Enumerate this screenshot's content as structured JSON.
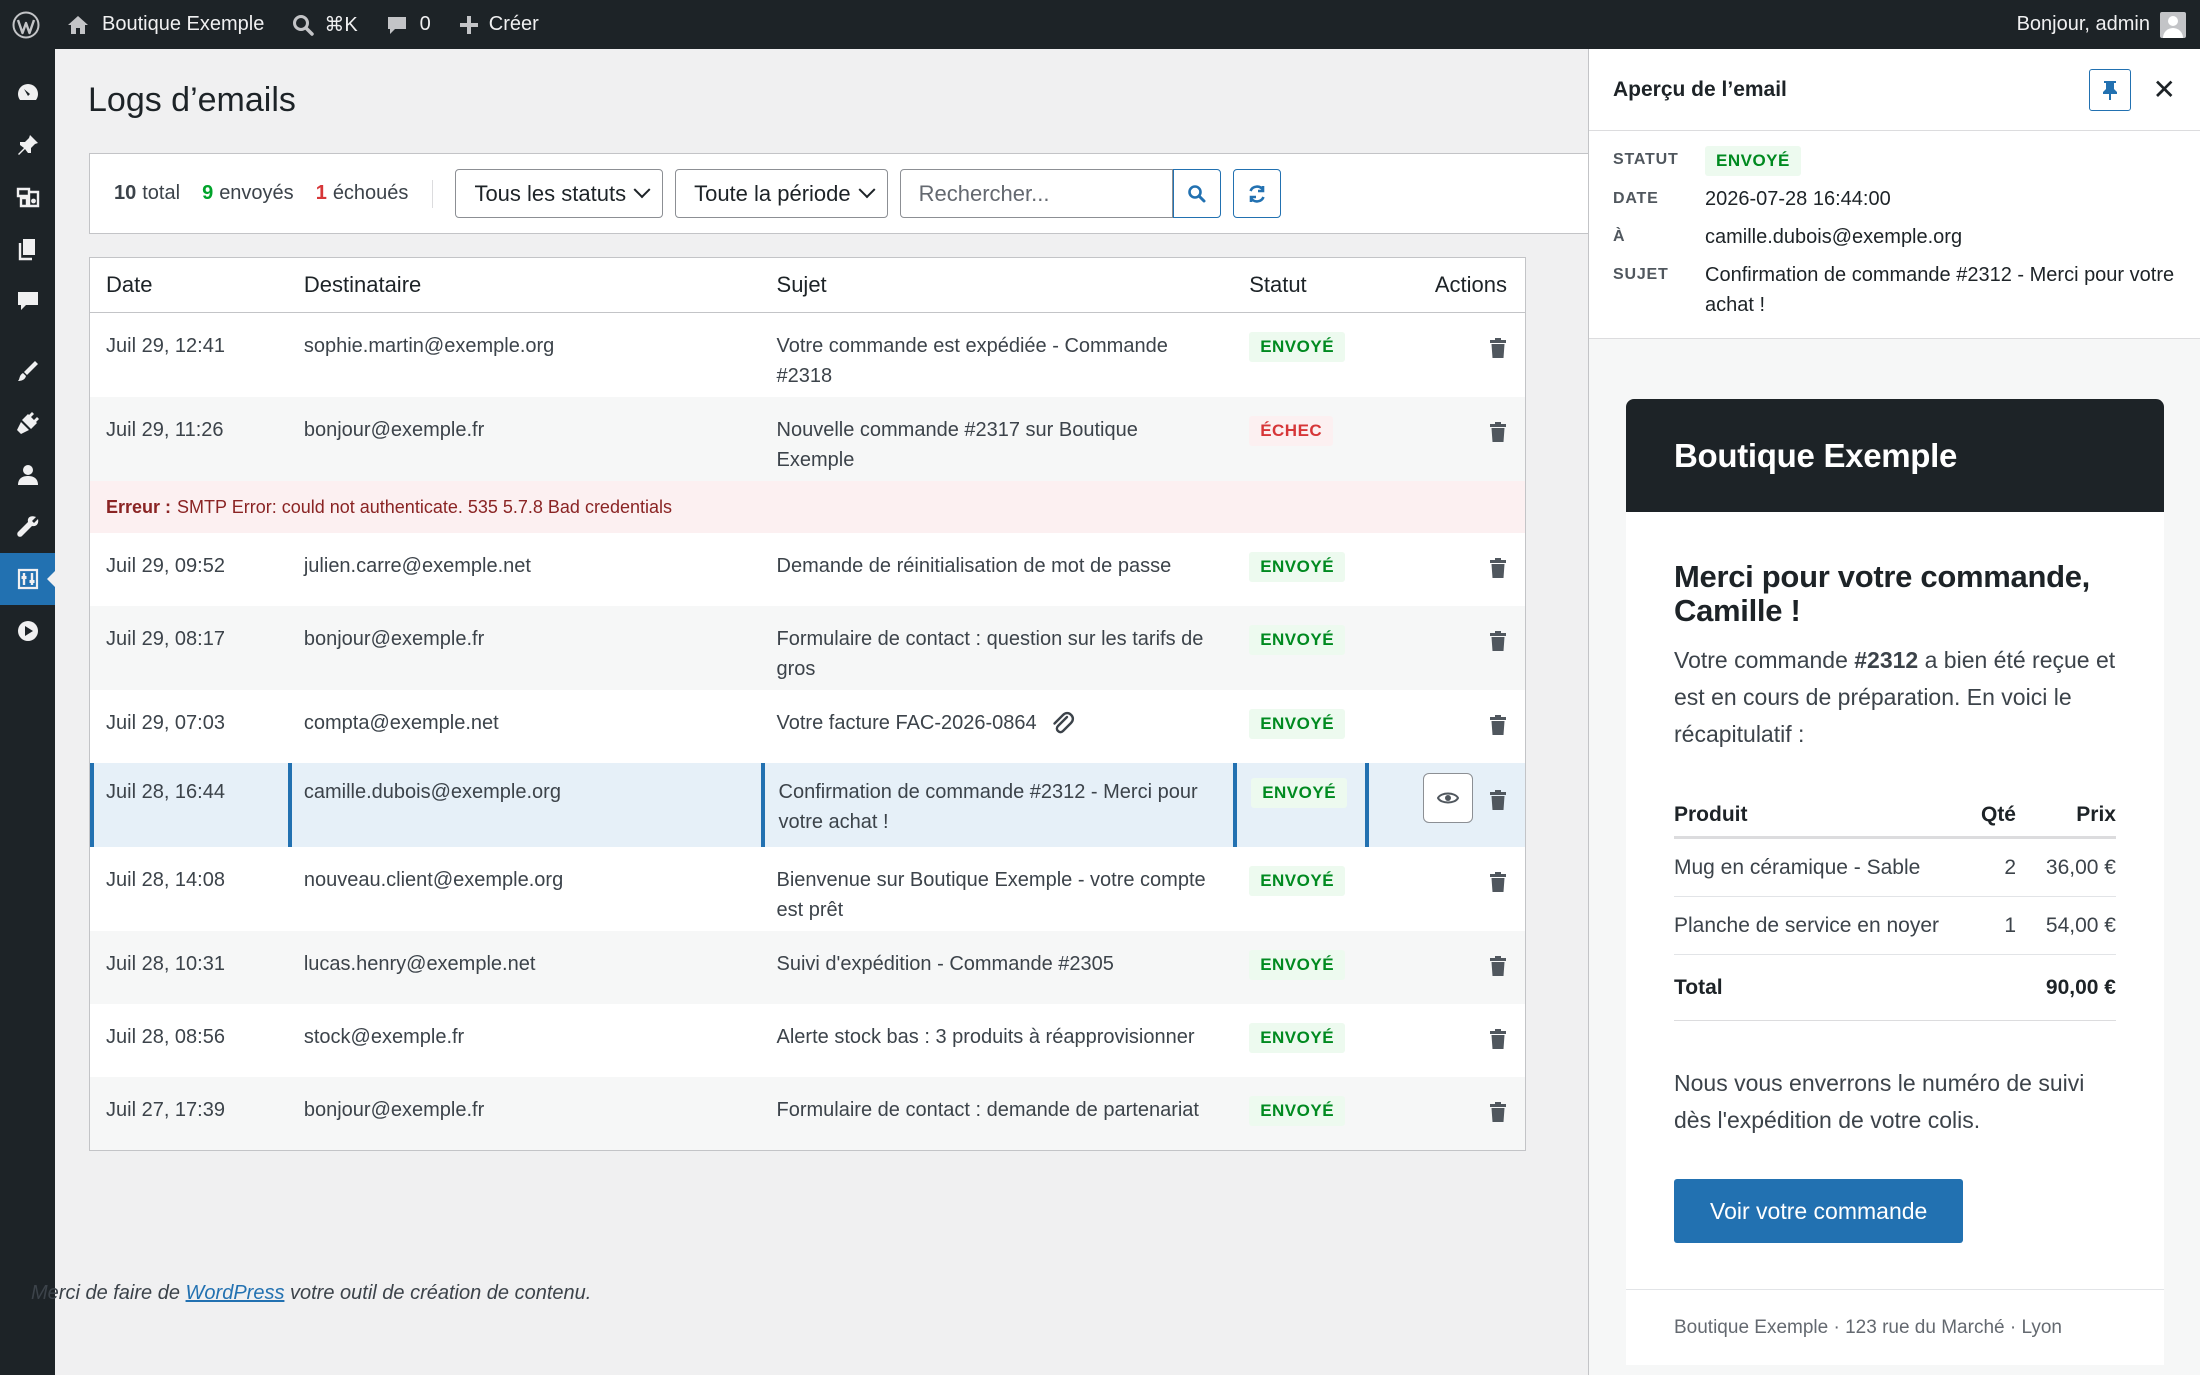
{
  "adminbar": {
    "site_name": "Boutique Exemple",
    "shortcut": "⌘K",
    "comments_count": "0",
    "create_label": "Créer",
    "greeting": "Bonjour, admin"
  },
  "page": {
    "title": "Logs d’emails"
  },
  "toolbar": {
    "total_count": "10",
    "total_label": "total",
    "sent_count": "9",
    "sent_label": "envoyés",
    "failed_count": "1",
    "failed_label": "échoués",
    "status_filter": "Tous les statuts",
    "period_filter": "Toute la période",
    "search_placeholder": "Rechercher..."
  },
  "table": {
    "headers": {
      "date": "Date",
      "recipient": "Destinataire",
      "subject": "Sujet",
      "status": "Statut",
      "actions": "Actions"
    },
    "rows": [
      {
        "date": "Juil 29, 12:41",
        "recipient": "sophie.martin@exemple.org",
        "subject": "Votre commande est expédiée - Commande #2318",
        "status": "ENVOYÉ"
      },
      {
        "date": "Juil 29, 11:26",
        "recipient": "bonjour@exemple.fr",
        "subject": "Nouvelle commande #2317 sur Boutique Exemple",
        "status": "ÉCHEC"
      },
      {
        "date": "Juil 29, 09:52",
        "recipient": "julien.carre@exemple.net",
        "subject": "Demande de réinitialisation de mot de passe",
        "status": "ENVOYÉ"
      },
      {
        "date": "Juil 29, 08:17",
        "recipient": "bonjour@exemple.fr",
        "subject": "Formulaire de contact : question sur les tarifs de gros",
        "status": "ENVOYÉ"
      },
      {
        "date": "Juil 29, 07:03",
        "recipient": "compta@exemple.net",
        "subject": "Votre facture FAC-2026-0864",
        "status": "ENVOYÉ"
      },
      {
        "date": "Juil 28, 16:44",
        "recipient": "camille.dubois@exemple.org",
        "subject": "Confirmation de commande #2312 - Merci pour votre achat !",
        "status": "ENVOYÉ"
      },
      {
        "date": "Juil 28, 14:08",
        "recipient": "nouveau.client@exemple.org",
        "subject": "Bienvenue sur Boutique Exemple - votre compte est prêt",
        "status": "ENVOYÉ"
      },
      {
        "date": "Juil 28, 10:31",
        "recipient": "lucas.henry@exemple.net",
        "subject": "Suivi d'expédition - Commande #2305",
        "status": "ENVOYÉ"
      },
      {
        "date": "Juil 28, 08:56",
        "recipient": "stock@exemple.fr",
        "subject": "Alerte stock bas : 3 produits à réapprovisionner",
        "status": "ENVOYÉ"
      },
      {
        "date": "Juil 27, 17:39",
        "recipient": "bonjour@exemple.fr",
        "subject": "Formulaire de contact : demande de partenariat",
        "status": "ENVOYÉ"
      }
    ],
    "error": {
      "label": "Erreur :",
      "message": "SMTP Error: could not authenticate. 535 5.7.8 Bad credentials"
    }
  },
  "footer": {
    "prefix": "Merci de faire de",
    "link": "WordPress",
    "suffix": "votre outil de création de contenu."
  },
  "preview": {
    "title": "Aperçu de l’email",
    "meta": {
      "status_label": "STATUT",
      "status": "ENVOYÉ",
      "date_label": "DATE",
      "date": "2026-07-28 16:44:00",
      "to_label": "À",
      "to": "camille.dubois@exemple.org",
      "subject_label": "SUJET",
      "subject": "Confirmation de commande #2312 - Merci pour votre achat !"
    },
    "email": {
      "brand": "Boutique Exemple",
      "heading": "Merci pour votre commande, Camille !",
      "intro_before": "Votre commande",
      "order_number": "#2312",
      "intro_after": "a bien été reçue et est en cours de préparation. En voici le récapitulatif :",
      "table_headers": {
        "product": "Produit",
        "qty": "Qté",
        "price": "Prix"
      },
      "items": [
        {
          "product": "Mug en céramique - Sable",
          "qty": "2",
          "price": "36,00 €"
        },
        {
          "product": "Planche de service en noyer",
          "qty": "1",
          "price": "54,00 €"
        }
      ],
      "total_label": "Total",
      "total": "90,00 €",
      "closing": "Nous vous enverrons le numéro de suivi dès l'expédition de votre colis.",
      "cta": "Voir votre commande",
      "footer": "Boutique Exemple · 123 rue du Marché · Lyon"
    }
  },
  "colors": {
    "accent": "#2271b1",
    "sent": "#008a20",
    "failed": "#d63638",
    "adminbar": "#1d2327"
  }
}
